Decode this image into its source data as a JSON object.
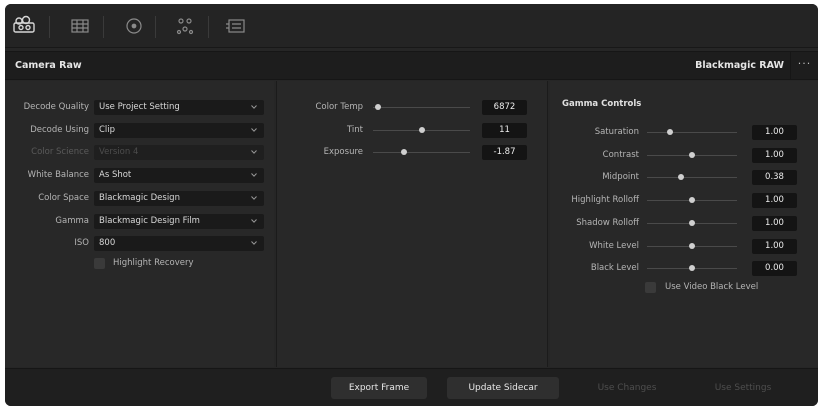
{
  "toolbar": {
    "icons": [
      "camera-raw-icon",
      "color-match-icon",
      "color-wheels-icon",
      "nodes-icon",
      "metadata-icon"
    ]
  },
  "header": {
    "title": "Camera Raw",
    "preset": "Blackmagic RAW",
    "more": "···"
  },
  "decode": {
    "rows": [
      {
        "label": "Decode Quality",
        "value": "Use Project Setting",
        "enabled": true
      },
      {
        "label": "Decode Using",
        "value": "Clip",
        "enabled": true
      },
      {
        "label": "Color Science",
        "value": "Version 4",
        "enabled": false
      },
      {
        "label": "White Balance",
        "value": "As Shot",
        "enabled": true
      },
      {
        "label": "Color Space",
        "value": "Blackmagic Design",
        "enabled": true
      },
      {
        "label": "Gamma",
        "value": "Blackmagic Design Film",
        "enabled": true
      },
      {
        "label": "ISO",
        "value": "800",
        "enabled": true
      }
    ],
    "highlight_recovery": {
      "label": "Highlight Recovery",
      "checked": false
    }
  },
  "image": {
    "rows": [
      {
        "label": "Color Temp",
        "value": "6872",
        "slider": 0.05
      },
      {
        "label": "Tint",
        "value": "11",
        "slider": 0.5
      },
      {
        "label": "Exposure",
        "value": "-1.87",
        "slider": 0.32
      }
    ]
  },
  "gamma_controls": {
    "title": "Gamma Controls",
    "rows": [
      {
        "label": "Saturation",
        "value": "1.00",
        "slider": 0.25
      },
      {
        "label": "Contrast",
        "value": "1.00",
        "slider": 0.5
      },
      {
        "label": "Midpoint",
        "value": "0.38",
        "slider": 0.38
      },
      {
        "label": "Highlight Rolloff",
        "value": "1.00",
        "slider": 0.5
      },
      {
        "label": "Shadow Rolloff",
        "value": "1.00",
        "slider": 0.5
      },
      {
        "label": "White Level",
        "value": "1.00",
        "slider": 0.5
      },
      {
        "label": "Black Level",
        "value": "0.00",
        "slider": 0.5
      }
    ],
    "use_video_black_level": {
      "label": "Use Video Black Level",
      "checked": false
    }
  },
  "footer": {
    "export_frame": "Export Frame",
    "update_sidecar": "Update Sidecar",
    "use_changes": "Use Changes",
    "use_settings": "Use Settings"
  }
}
